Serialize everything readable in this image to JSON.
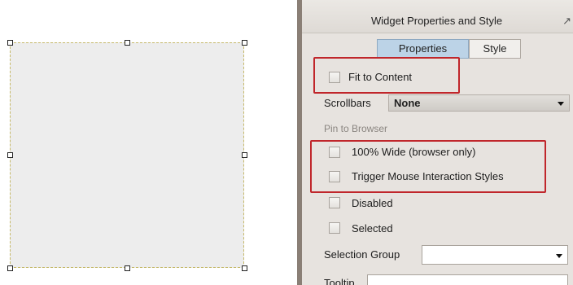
{
  "panel": {
    "title": "Widget Properties and Style",
    "pin_icon": "pin-icon",
    "tabs": [
      {
        "label": "Properties",
        "active": true
      },
      {
        "label": "Style",
        "active": false
      }
    ],
    "fit_to_content": {
      "label": "Fit to Content",
      "checked": false
    },
    "scrollbars": {
      "label": "Scrollbars",
      "value": "None"
    },
    "pin_to_browser_label": "Pin to Browser",
    "wide_100": {
      "label": "100% Wide (browser only)",
      "checked": false
    },
    "trigger_mouse": {
      "label": "Trigger Mouse Interaction Styles",
      "checked": false
    },
    "disabled": {
      "label": "Disabled",
      "checked": false
    },
    "selected": {
      "label": "Selected",
      "checked": false
    },
    "selection_group": {
      "label": "Selection Group",
      "value": ""
    },
    "tooltip": {
      "label": "Tooltip",
      "value": ""
    }
  },
  "colors": {
    "highlight": "#c0262b",
    "active_tab": "#bcd3e7",
    "panel_bg": "#e7e3df"
  }
}
